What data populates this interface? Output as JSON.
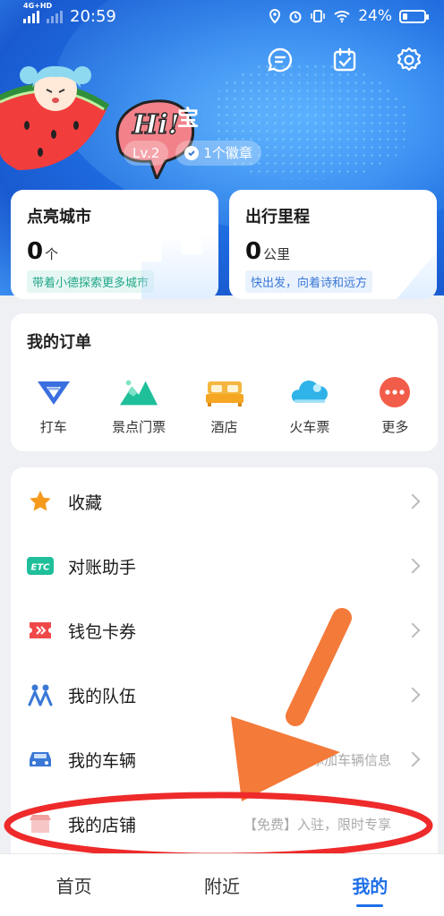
{
  "status_bar": {
    "network": "4G+HD",
    "time": "20:59",
    "battery": "24%",
    "battery_level": 0.24,
    "icons": [
      "location-icon",
      "alarm-icon",
      "vibrate-icon",
      "wifi-icon",
      "battery-icon"
    ]
  },
  "header": {
    "icons": [
      "message-icon",
      "checkin-calendar-icon",
      "settings-gear-icon"
    ],
    "mascot_text": "Hi!",
    "username_tail": "宝",
    "level": "Lv.2",
    "badge_text": "1个徽章"
  },
  "stats": {
    "cities": {
      "title": "点亮城市",
      "value": "0",
      "unit": "个",
      "tag": "带着小德探索更多城市"
    },
    "mileage": {
      "title": "出行里程",
      "value": "0",
      "unit": "公里",
      "tag": "快出发，向着诗和远方"
    }
  },
  "orders": {
    "title": "我的订单",
    "items": [
      {
        "label": "打车",
        "icon": "taxi-icon",
        "color": "#3a6fe0"
      },
      {
        "label": "景点门票",
        "icon": "mountain-ticket-icon",
        "color": "#1fbf9a"
      },
      {
        "label": "酒店",
        "icon": "hotel-bed-icon",
        "color": "#f5a623"
      },
      {
        "label": "火车票",
        "icon": "train-cloud-icon",
        "color": "#2fb3e8"
      },
      {
        "label": "更多",
        "icon": "more-dots-icon",
        "color": "#f25d4a"
      }
    ]
  },
  "menu": {
    "items": [
      {
        "label": "收藏",
        "icon": "star-icon",
        "hint": ""
      },
      {
        "label": "对账助手",
        "icon": "etc-icon",
        "hint": ""
      },
      {
        "label": "钱包卡券",
        "icon": "ticket-coupon-icon",
        "hint": ""
      },
      {
        "label": "我的队伍",
        "icon": "team-people-icon",
        "hint": ""
      },
      {
        "label": "我的车辆",
        "icon": "car-icon",
        "hint": "添加车辆信息"
      },
      {
        "label": "我的店铺",
        "icon": "shop-icon",
        "hint": "【免费】入驻，限时专享"
      }
    ]
  },
  "bottom_nav": {
    "items": [
      {
        "label": "首页",
        "active": false
      },
      {
        "label": "附近",
        "active": false
      },
      {
        "label": "我的",
        "active": true
      }
    ]
  },
  "colors": {
    "header_blue": "#1f6fe3",
    "accent_blue": "#1e6fe8",
    "annotation_orange": "#f47a3a",
    "annotation_red": "#ee2a2a"
  }
}
